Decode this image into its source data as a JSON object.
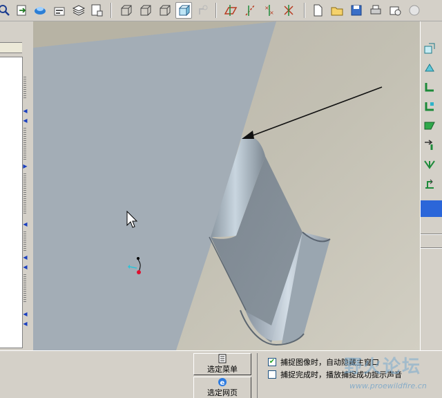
{
  "toolbar": {
    "icons": [
      "zoom-icon",
      "insert-icon",
      "orient-icon",
      "text-style-icon",
      "layer-icon",
      "model-tree-icon",
      "wireframe-icon",
      "hidden-line-icon",
      "no-hidden-icon",
      "shading-icon",
      "spin-center-icon",
      "datum-plane-icon",
      "datum-axis-icon",
      "datum-point-icon",
      "coordinate-system-icon",
      "new-icon",
      "open-icon",
      "save-icon",
      "print-icon",
      "email-icon",
      "send-icon"
    ],
    "pressed": "shading-icon"
  },
  "right_toolbar": {
    "icons": [
      "extrude-icon",
      "revolve-icon",
      "flange-wall-icon",
      "unattached-wall-icon",
      "edge-bend-icon",
      "unbend-icon",
      "bend-back-icon",
      "form-icon"
    ]
  },
  "bottom": {
    "buttons": [
      {
        "label": "选定菜单",
        "icon": "menu-icon"
      },
      {
        "label": "选定网页",
        "icon": "browser-icon"
      }
    ],
    "options": [
      {
        "label": "捕捉图像时，自动隐藏主窗口",
        "checked": true
      },
      {
        "label": "捕捉完成时，播放捕捉成功提示声音",
        "checked": false
      }
    ]
  },
  "watermark": {
    "title": "野火论坛",
    "url": "www.proewildfire.cn"
  },
  "colors": {
    "model_face": "#a3adb6",
    "background": "#c2beb1",
    "accent_blue": "#2b66d9"
  }
}
